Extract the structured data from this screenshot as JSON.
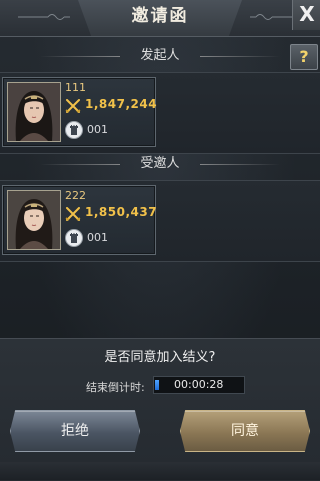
{
  "dialog": {
    "title": "邀请函",
    "close_label": "X",
    "help_label": "?"
  },
  "initiator": {
    "header": "发起人",
    "name": "111",
    "power": "1,847,244",
    "server": "001"
  },
  "invitee": {
    "header": "受邀人",
    "name": "222",
    "power": "1,850,437",
    "server": "001"
  },
  "prompt": {
    "question": "是否同意加入结义?",
    "countdown_label": "结束倒计时:",
    "countdown_value": "00:00:28",
    "countdown_progress": 0.05
  },
  "buttons": {
    "reject": "拒绝",
    "agree": "同意"
  },
  "icons": {
    "power": "crossed-swords-icon",
    "server": "tower-icon",
    "close": "close-icon",
    "help": "question-icon"
  },
  "colors": {
    "power_text": "#f1c14a",
    "name_text": "#e9c980",
    "reject_button": "#4b5563",
    "agree_button": "#8b7755",
    "countdown_fill": "#1f6ed8"
  }
}
